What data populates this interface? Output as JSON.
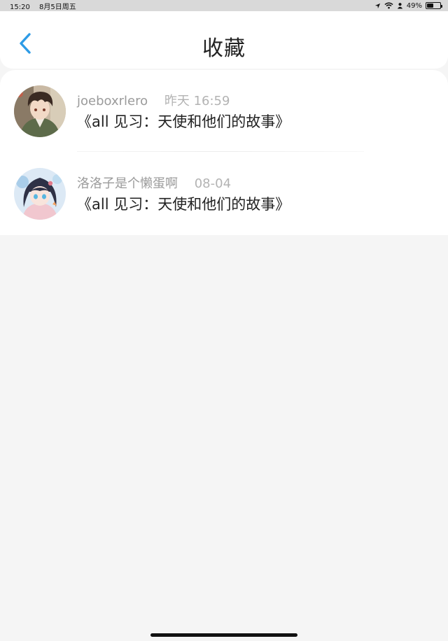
{
  "status_bar": {
    "time": "15:20",
    "date": "8月5日周五",
    "battery": "49%",
    "battery_level": 0.49,
    "icons": [
      "location-icon",
      "wifi-icon",
      "person-icon",
      "battery-icon"
    ]
  },
  "header": {
    "title": "收藏",
    "back_icon": "chevron-left-icon",
    "accent": "#2d9be6"
  },
  "favorites": [
    {
      "user": "joeboxrlero",
      "time": "昨天 16:59",
      "title": "《all 见习：天使和他们的故事》"
    },
    {
      "user": "洛洛子是个懒蛋啊",
      "time": "08-04",
      "title": "《all 见习：天使和他们的故事》"
    }
  ]
}
